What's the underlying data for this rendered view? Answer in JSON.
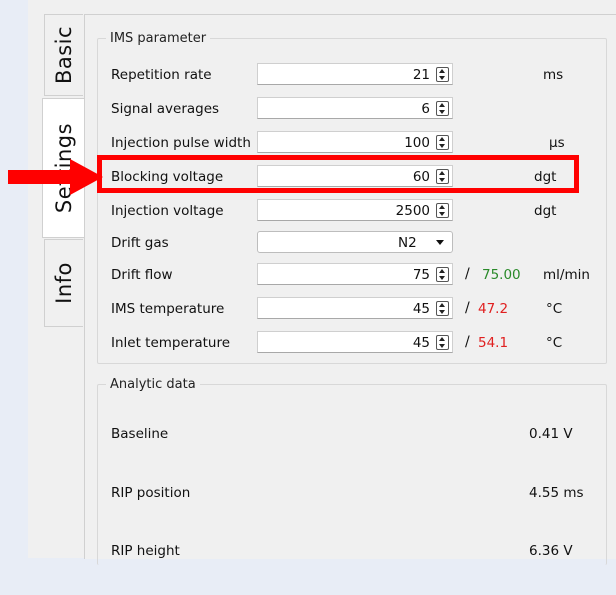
{
  "tabs": {
    "basic": "Basic",
    "settings": "Settings",
    "info": "Info"
  },
  "ims": {
    "title": "IMS parameter",
    "rows": [
      {
        "label": "Repetition rate",
        "value": "21",
        "unit": "ms"
      },
      {
        "label": "Signal averages",
        "value": "6",
        "unit": ""
      },
      {
        "label": "Injection pulse width",
        "value": "100",
        "unit": "µs"
      },
      {
        "label": "Blocking voltage",
        "value": "60",
        "unit": "dgt"
      },
      {
        "label": "Injection voltage",
        "value": "2500",
        "unit": "dgt"
      },
      {
        "label": "Drift gas",
        "value": "N2",
        "unit": ""
      },
      {
        "label": "Drift flow",
        "value": "75",
        "separator": "/",
        "actual": "75.00",
        "unit": "ml/min"
      },
      {
        "label": "IMS temperature",
        "value": "45",
        "separator": "/",
        "actual": "47.2",
        "unit": "°C"
      },
      {
        "label": "Inlet temperature",
        "value": "45",
        "separator": "/",
        "actual": "54.1",
        "unit": "°C"
      }
    ]
  },
  "analytic": {
    "title": "Analytic data",
    "rows": [
      {
        "label": "Baseline",
        "value": "0.41  V"
      },
      {
        "label": "RIP position",
        "value": "4.55  ms"
      },
      {
        "label": "RIP height",
        "value": "6.36  V"
      }
    ]
  },
  "colors": {
    "highlight": "#ff0000",
    "actual_ok": "#2a8a2a",
    "actual_warn": "#e02020"
  }
}
